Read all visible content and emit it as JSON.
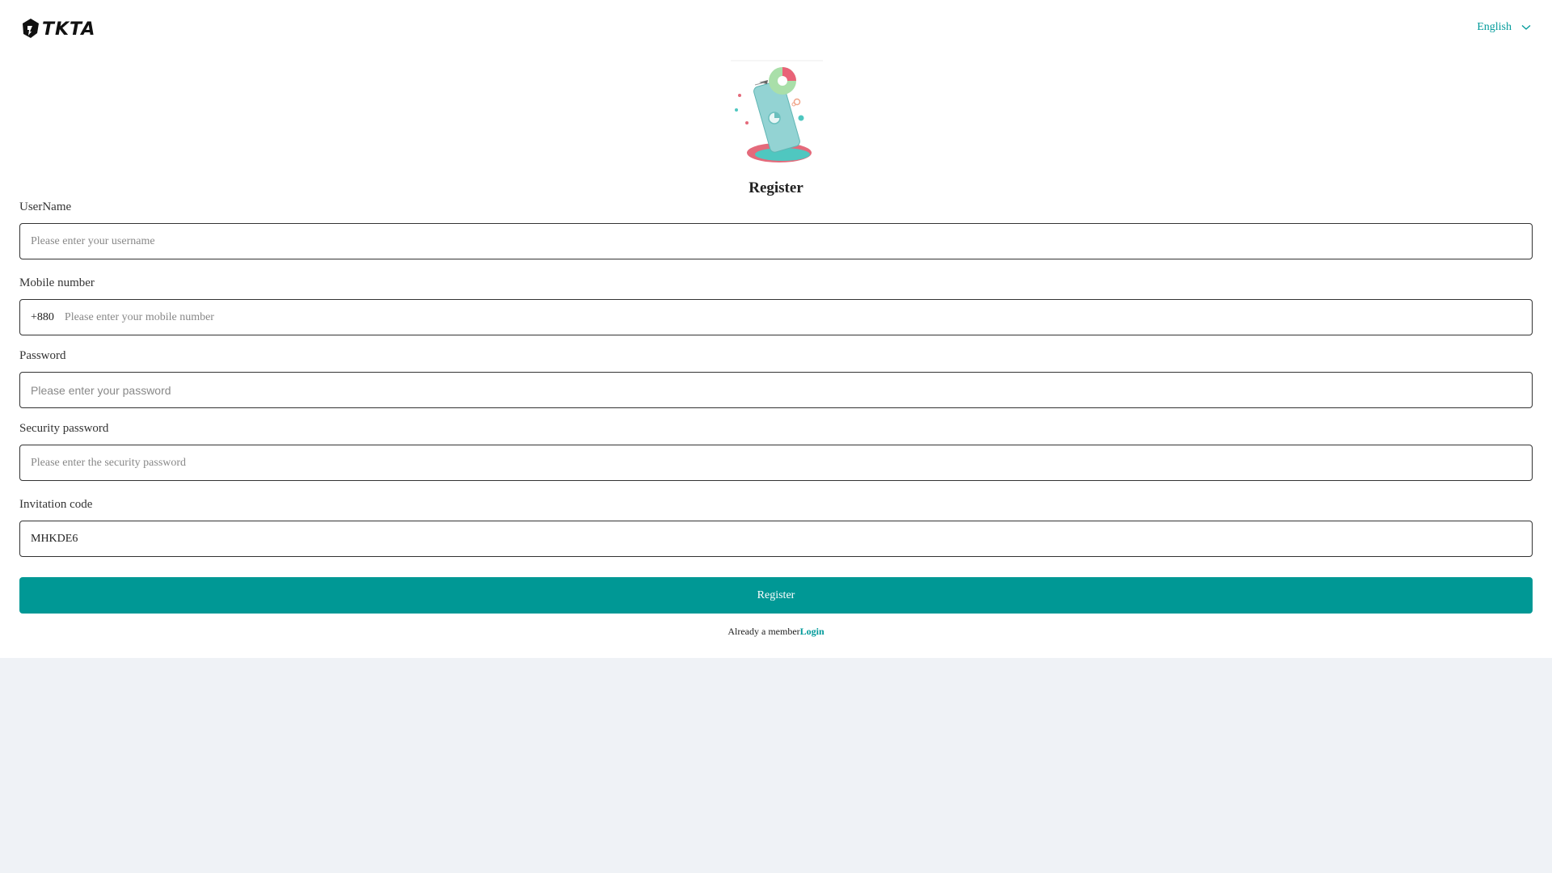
{
  "header": {
    "logo_text": "TKTA",
    "language": "English"
  },
  "title": "Register",
  "form": {
    "username": {
      "label": "UserName",
      "placeholder": "Please enter your username",
      "value": ""
    },
    "mobile": {
      "label": "Mobile number",
      "prefix": "+880",
      "placeholder": "Please enter your mobile number",
      "value": ""
    },
    "password": {
      "label": "Password",
      "placeholder": "Please enter your password",
      "value": ""
    },
    "security_password": {
      "label": "Security password",
      "placeholder": "Please enter the security password",
      "value": ""
    },
    "invitation": {
      "label": "Invitation code",
      "placeholder": "",
      "value": "MHKDE6"
    },
    "submit_label": "Register"
  },
  "footer": {
    "prompt": "Already a member",
    "login_link": "Login"
  },
  "colors": {
    "accent": "#009895",
    "link": "#009a9a",
    "page_bg": "#eff2f6"
  },
  "icons": {
    "logo": "logo-icon",
    "language_chevron": "chevron-down-icon",
    "illustration": "phone-chart-illustration"
  }
}
